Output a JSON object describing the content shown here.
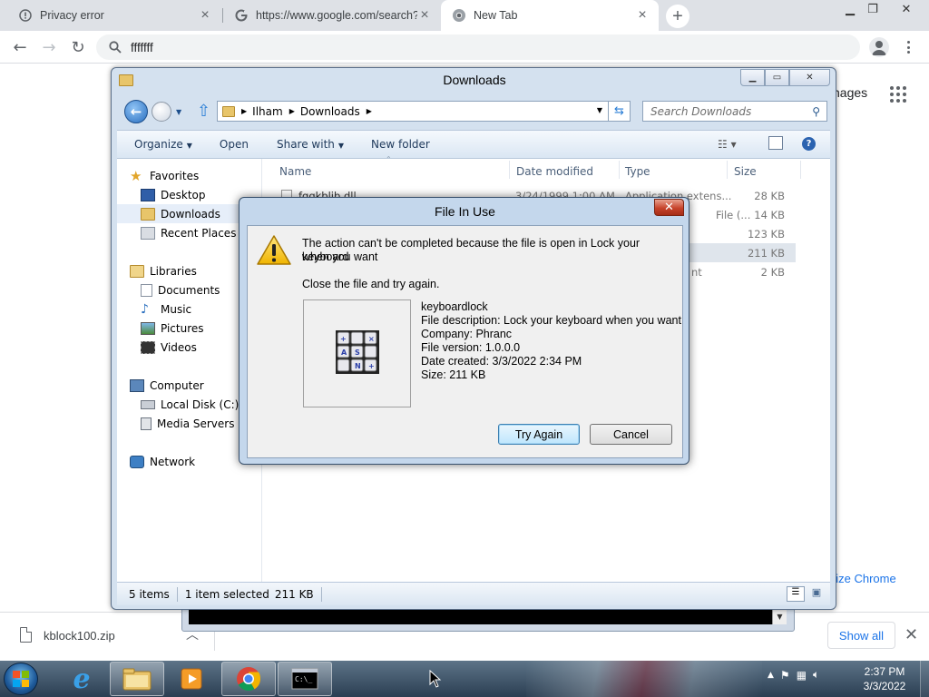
{
  "browser": {
    "tabs": [
      {
        "title": "Privacy error",
        "icon": "warning-tab-icon"
      },
      {
        "title": "https://www.google.com/search?",
        "icon": "google-g-icon"
      },
      {
        "title": "New Tab",
        "icon": "chrome-icon"
      }
    ],
    "new_tab": "+",
    "omnibox_text": "fffffff",
    "images_link": "nages",
    "customize_link": "nize Chrome"
  },
  "download_shelf": {
    "file_name": "kblock100.zip",
    "show_all": "Show all",
    "close": "✕"
  },
  "explorer": {
    "title": "Downloads",
    "breadcrumb": [
      "Ilham",
      "Downloads"
    ],
    "search_placeholder": "Search Downloads",
    "commands": {
      "organize": "Organize",
      "open": "Open",
      "share_with": "Share with",
      "new_folder": "New folder"
    },
    "nav": {
      "favorites": "Favorites",
      "desktop": "Desktop",
      "downloads": "Downloads",
      "recent_places": "Recent Places",
      "libraries": "Libraries",
      "documents": "Documents",
      "music": "Music",
      "pictures": "Pictures",
      "videos": "Videos",
      "computer": "Computer",
      "local_disk": "Local Disk (C:)",
      "media_servers": "Media Servers",
      "network": "Network"
    },
    "columns": {
      "name": "Name",
      "date": "Date modified",
      "type": "Type",
      "size": "Size"
    },
    "rows": [
      {
        "name": "fgqkblib.dll",
        "date": "3/24/1999 1:00 AM",
        "type": "Application extens...",
        "size": "28 KB"
      },
      {
        "name": "",
        "date": "",
        "type": "File (...",
        "size": "14 KB"
      },
      {
        "name": "",
        "date": "",
        "type": "",
        "size": "123 KB"
      },
      {
        "name": "",
        "date": "",
        "type": "",
        "size": "211 KB"
      },
      {
        "name": "",
        "date": "",
        "type": "nt",
        "size": "2 KB"
      }
    ],
    "status": {
      "items": "5 items",
      "selected": "1 item selected",
      "size": "211 KB"
    }
  },
  "dialog": {
    "title": "File In Use",
    "close": "✕",
    "message_line1": "The action can't be completed because the file is open in Lock your keyboard",
    "message_line2": "when you want",
    "instruction": "Close the file and try again.",
    "file_name": "keyboardlock",
    "description": "File description: Lock your keyboard when you want",
    "company": "Company: Phranc",
    "version": "File version: 1.0.0.0",
    "date_created": "Date created: 3/3/2022 2:34 PM",
    "size": "Size: 211 KB",
    "try_again": "Try Again",
    "cancel": "Cancel"
  },
  "taskbar": {
    "time": "2:37 PM",
    "date": "3/3/2022"
  },
  "colors": {
    "chrome_tabbar": "#dee1e6",
    "chrome_link": "#1a73e8",
    "explorer_frame": "#d4e1ef",
    "dialog_frame": "#c4d7ec",
    "dialog_close": "#c7432b",
    "taskbar": "#2b3e52"
  }
}
